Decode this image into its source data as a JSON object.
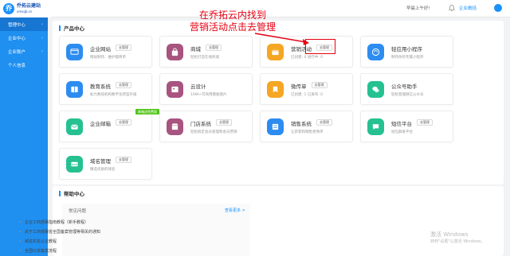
{
  "logo": {
    "name": "乔拓云建站",
    "url": "xmsqb.cn"
  },
  "header": {
    "greeting": "早晨上午好!",
    "user_menu": "企业概括"
  },
  "sidebar": {
    "items": [
      {
        "label": "管理中心",
        "chevron": "‹"
      },
      {
        "label": "企业中心",
        "chevron": "›"
      },
      {
        "label": "企业账户",
        "chevron": "›"
      },
      {
        "label": "个人信息",
        "chevron": ""
      }
    ]
  },
  "product_center": {
    "title": "产品中心",
    "cards": [
      {
        "name": "企业网站",
        "desc": "网站制作、维护都简单",
        "btn": "去管理",
        "icon": "website-icon",
        "color": "#2d8cf0"
      },
      {
        "name": "商城",
        "desc": "轻松打造在线商城",
        "btn": "去管理",
        "icon": "shop-bag-icon",
        "color": "#a7547f"
      },
      {
        "name": "营销活动",
        "desc": "已创建: 0    进行中: 0",
        "btn": "去管理",
        "icon": "marketing-icon",
        "color": "#f5a623"
      },
      {
        "name": "轻应用小程序",
        "desc": "制作你的专属小程序",
        "btn": "",
        "icon": "miniapp-icon",
        "color": "#2d8cf0"
      },
      {
        "name": "教育系统",
        "desc": "助力教培机构数字化转型升级",
        "btn": "去管理",
        "icon": "education-icon",
        "color": "#2d8cf0"
      },
      {
        "name": "云设计",
        "desc": "10W+可商用模板图片",
        "btn": "",
        "icon": "design-icon",
        "color": "#a7547f"
      },
      {
        "name": "微传单",
        "desc": "已创建: 1    已发布: 0",
        "btn": "去管理",
        "icon": "flyer-icon",
        "color": "#f5a623"
      },
      {
        "name": "公众号助手",
        "desc": "轻松管理微信公众号",
        "btn": "",
        "icon": "wechat-icon",
        "color": "#25c191"
      },
      {
        "name": "企业邮箱",
        "desc": "",
        "btn": "去管理",
        "icon": "email-icon",
        "color": "#25c191",
        "badge": "邮箱送免费版"
      },
      {
        "name": "门店系统",
        "desc": "轻松搞定会员管理和会员营销",
        "btn": "去管理",
        "icon": "store-icon",
        "color": "#a7547f"
      },
      {
        "name": "销售系统",
        "desc": "让获客和销售更简单",
        "btn": "去管理",
        "icon": "sales-icon",
        "color": "#2d8cf0"
      },
      {
        "name": "短信平台",
        "desc": "短信群发平台",
        "btn": "去管理",
        "icon": "sms-icon",
        "color": "#25c191"
      },
      {
        "name": "域名管理",
        "desc": "精选优质的域名",
        "btn": "去管理",
        "icon": "domain-icon",
        "color": "#25c191"
      }
    ]
  },
  "annotation": {
    "line1": "在乔拓云内找到",
    "line2": "营销活动点击去管理"
  },
  "help_center": {
    "title": "帮助中心",
    "faq_title": "常见问题",
    "more": "查看更多 >",
    "items": [
      "企业工商部署指南教程（新手教程）",
      "关于工商部署省全国备案管理等相关的通知",
      "域名实名认证教程",
      "全国公安备案流程"
    ]
  },
  "watermark": {
    "line1": "激活 Windows",
    "line2": "转到\"设置\"以激活 Windows。"
  }
}
